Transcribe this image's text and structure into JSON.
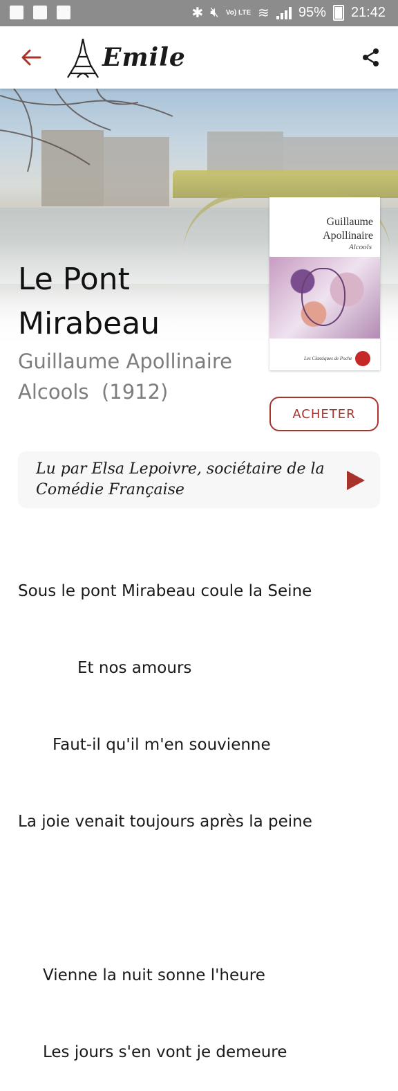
{
  "status_bar": {
    "lte": "Vo) LTE",
    "battery": "95%",
    "time": "21:42"
  },
  "app_bar": {
    "logo_text": "Emile",
    "back_icon": "arrow-left-icon",
    "share_icon": "share-icon"
  },
  "poem": {
    "title": "Le Pont Mirabeau",
    "author": "Guillaume Apollinaire",
    "work": "Alcools",
    "year": "(1912)"
  },
  "cover": {
    "author_line1": "Guillaume",
    "author_line2": "Apollinaire",
    "work": "Alcools",
    "series": "Les Classiques de Poche",
    "badge": "Livre de Poche"
  },
  "buy_button": "ACHETER",
  "audio": {
    "label": "Lu par Elsa Lepoivre, sociétaire de la Comédie Française"
  },
  "poem_text": {
    "lines": [
      "Sous le pont Mirabeau coule la Seine",
      "Et nos amours",
      "Faut-il qu'il m'en souvienne",
      "La joie venait toujours après la peine",
      "",
      "Vienne la nuit sonne l'heure",
      "Les jours s'en vont je demeure"
    ]
  },
  "colors": {
    "accent": "#a8322c",
    "status_bar": "#8c8c8c"
  }
}
